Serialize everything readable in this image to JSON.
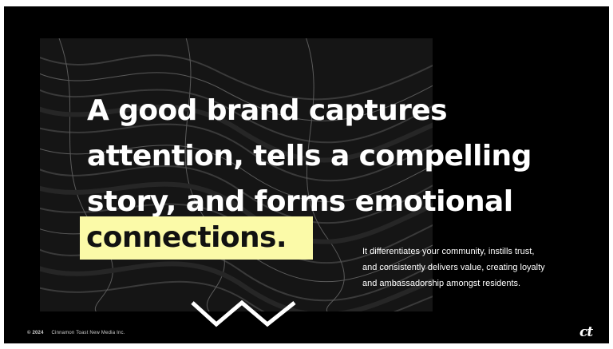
{
  "slide": {
    "headline_lines": [
      "A good brand captures",
      "attention, tells a compelling",
      "story, and forms emotional"
    ],
    "highlight_word": "connections.",
    "body_lines": [
      "It differentiates your community, instills trust,",
      "and consistently delivers value, creating loyalty",
      "and ambassadorship amongst residents."
    ],
    "footer": {
      "copyright": "© 2024",
      "company": "Cinnamon Toast New Media Inc."
    },
    "logo": "ct"
  },
  "colors": {
    "background": "#000000",
    "texture": "#151515",
    "highlight": "#fbfaa8",
    "text": "#ffffff"
  }
}
